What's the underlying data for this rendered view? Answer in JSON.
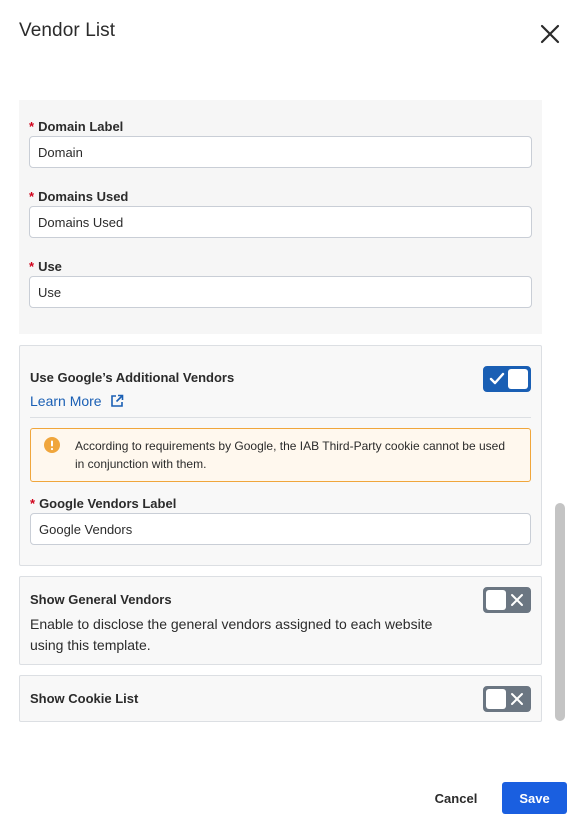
{
  "header": {
    "title": "Vendor List",
    "close_icon": "close-icon"
  },
  "form": {
    "required_mark": "*",
    "fields": [
      {
        "label": "Domain Label",
        "value": "Domain"
      },
      {
        "label": "Domains Used",
        "value": "Domains Used"
      },
      {
        "label": "Use",
        "value": "Use"
      }
    ]
  },
  "google_section": {
    "title": "Use Google’s Additional Vendors",
    "toggle_on": true,
    "learn_more": "Learn More",
    "learn_more_icon": "external-link-icon",
    "warning_icon": "warning-icon",
    "warning_text": "According to requirements by Google, the IAB Third-Party cookie cannot be used in conjunction with them.",
    "vendors_label": "Google Vendors Label",
    "vendors_value": "Google Vendors"
  },
  "general_vendors": {
    "title": "Show General Vendors",
    "description": "Enable to disclose the general vendors assigned to each website using this template.",
    "toggle_on": false
  },
  "cookie_list": {
    "title": "Show Cookie List",
    "toggle_on": false
  },
  "footer": {
    "cancel_label": "Cancel",
    "save_label": "Save"
  },
  "colors": {
    "accent": "#1a5fe0",
    "link": "#1a5fb4",
    "required": "#d0021b",
    "warning_border": "#f0a63c",
    "toggle_off": "#6b7682"
  }
}
